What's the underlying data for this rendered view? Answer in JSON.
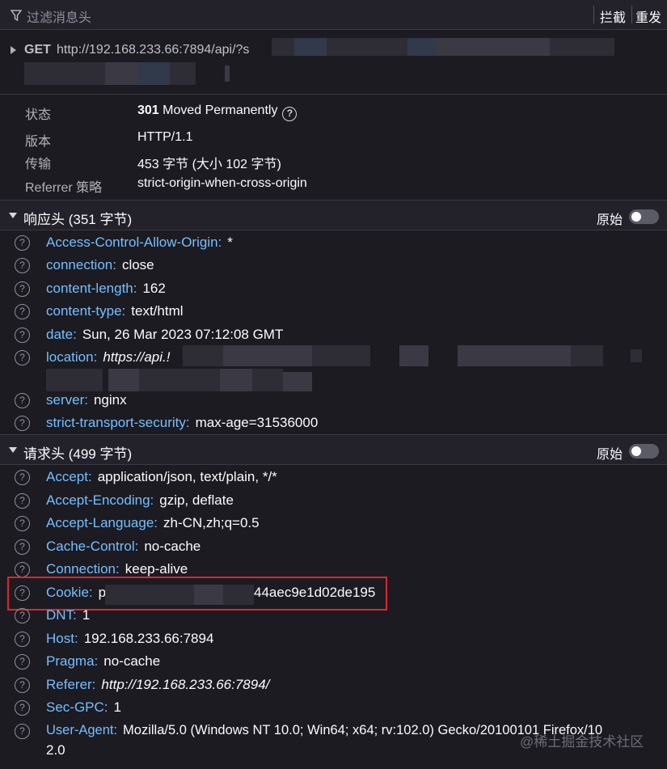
{
  "toolbar": {
    "filter_placeholder": "过滤消息头",
    "block_label": "拦截",
    "resend_label": "重发"
  },
  "request_line": {
    "method": "GET",
    "url": "http://192.168.233.66:7894/api/?s"
  },
  "summary": {
    "status_label": "状态",
    "status_code": "301",
    "status_text": "Moved Permanently",
    "version_label": "版本",
    "version_value": "HTTP/1.1",
    "transfer_label": "传输",
    "transfer_value": "453 字节 (大小 102 字节)",
    "referrer_label": "Referrer 策略",
    "referrer_value": "strict-origin-when-cross-origin"
  },
  "response_headers": {
    "title": "响应头 (351 字节)",
    "raw_label": "原始",
    "items": [
      {
        "name": "Access-Control-Allow-Origin:",
        "value": "*"
      },
      {
        "name": "connection:",
        "value": "close"
      },
      {
        "name": "content-length:",
        "value": "162"
      },
      {
        "name": "content-type:",
        "value": "text/html"
      },
      {
        "name": "date:",
        "value": "Sun, 26 Mar 2023 07:12:08 GMT"
      },
      {
        "name": "location:",
        "value": "https://api.!"
      },
      {
        "name": "server:",
        "value": "nginx"
      },
      {
        "name": "strict-transport-security:",
        "value": "max-age=31536000"
      }
    ]
  },
  "request_headers": {
    "title": "请求头 (499 字节)",
    "raw_label": "原始",
    "items": [
      {
        "name": "Accept:",
        "value": "application/json, text/plain, */*"
      },
      {
        "name": "Accept-Encoding:",
        "value": "gzip, deflate"
      },
      {
        "name": "Accept-Language:",
        "value": "zh-CN,zh;q=0.5"
      },
      {
        "name": "Cache-Control:",
        "value": "no-cache"
      },
      {
        "name": "Connection:",
        "value": "keep-alive"
      },
      {
        "name": "Cookie:",
        "value": "p",
        "value_tail": "44aec9e1d02de195"
      },
      {
        "name": "DNT:",
        "value": "1"
      },
      {
        "name": "Host:",
        "value": "192.168.233.66:7894"
      },
      {
        "name": "Pragma:",
        "value": "no-cache"
      },
      {
        "name": "Referer:",
        "value": "http://192.168.233.66:7894/"
      },
      {
        "name": "Sec-GPC:",
        "value": "1"
      },
      {
        "name": "User-Agent:",
        "value": "Mozilla/5.0 (Windows NT 10.0; Win64; x64; rv:102.0) Gecko/20100101 Firefox/10",
        "value_cont": "2.0"
      }
    ]
  },
  "watermark": "@稀土掘金技术社区",
  "colors": {
    "header_name": "#75bfff",
    "highlight_box": "#e0242b"
  }
}
